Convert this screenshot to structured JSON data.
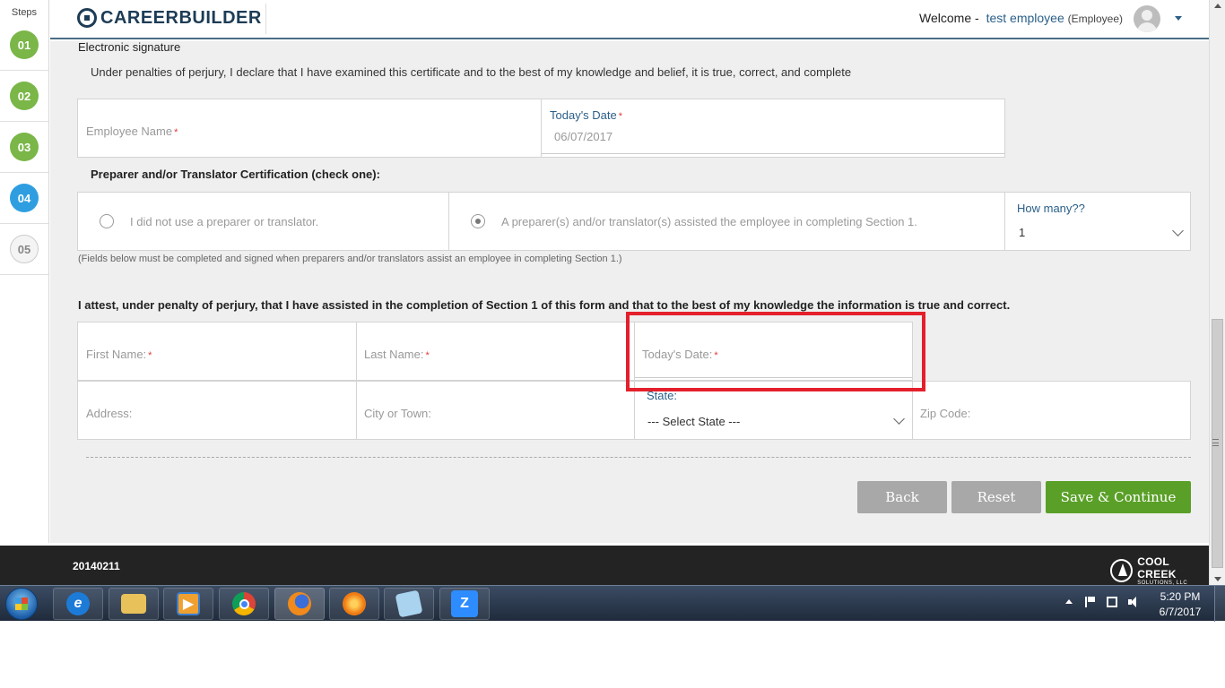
{
  "sidebar": {
    "title": "Steps",
    "steps": [
      {
        "label": "01",
        "state": "done"
      },
      {
        "label": "02",
        "state": "done"
      },
      {
        "label": "03",
        "state": "done"
      },
      {
        "label": "04",
        "state": "active"
      },
      {
        "label": "05",
        "state": "todo"
      }
    ]
  },
  "header": {
    "logo_text": "CAREERBUILDER",
    "welcome_prefix": "Welcome -",
    "user_name": "test employee",
    "user_role": "(Employee)"
  },
  "form": {
    "esig_heading": "Electronic signature",
    "declaration": "Under penalties of perjury, I declare that I have examined this certificate and to the best of my knowledge and belief, it is true, correct, and complete",
    "employee_name_placeholder": "Employee Name",
    "todays_date_label": "Today's Date",
    "todays_date_value": "06/07/2017",
    "required_mark": "*",
    "preparer_heading": "Preparer and/or Translator Certification (check one):",
    "option_no_preparer": "I did not use a preparer or translator.",
    "option_preparer": "A preparer(s) and/or translator(s) assisted the employee in completing Section 1.",
    "how_many_label": "How many??",
    "how_many_value": "1",
    "fields_note": "(Fields below must be completed and signed when preparers and/or translators assist an employee in completing Section 1.)",
    "attest_text": "I attest, under penalty of perjury, that I have assisted in the completion of Section 1 of this form and that to the best of my knowledge the information is true and correct.",
    "first_name_placeholder": "First Name:",
    "last_name_placeholder": "Last Name:",
    "prep_date_placeholder": "Today's Date:",
    "address_placeholder": "Address:",
    "city_placeholder": "City or Town:",
    "state_label": "State:",
    "state_value": "--- Select State ---",
    "zip_placeholder": "Zip Code:"
  },
  "buttons": {
    "back": "Back",
    "reset": "Reset",
    "save": "Save & Continue"
  },
  "footer": {
    "build": "20140211",
    "brand_name": "COOL CREEK",
    "brand_sub": "SOLUTIONS, LLC"
  },
  "taskbar": {
    "apps": [
      "internet-explorer",
      "file-explorer",
      "media-player",
      "chrome",
      "firefox",
      "app-orange",
      "notepad",
      "zoom"
    ],
    "time": "5:20 PM",
    "date": "6/7/2017"
  },
  "colors": {
    "accent_green": "#5aa028",
    "step_done": "#7ab648",
    "step_active": "#2e9ee0",
    "highlight_red": "#e3202b",
    "label_blue": "#2a5f88"
  }
}
